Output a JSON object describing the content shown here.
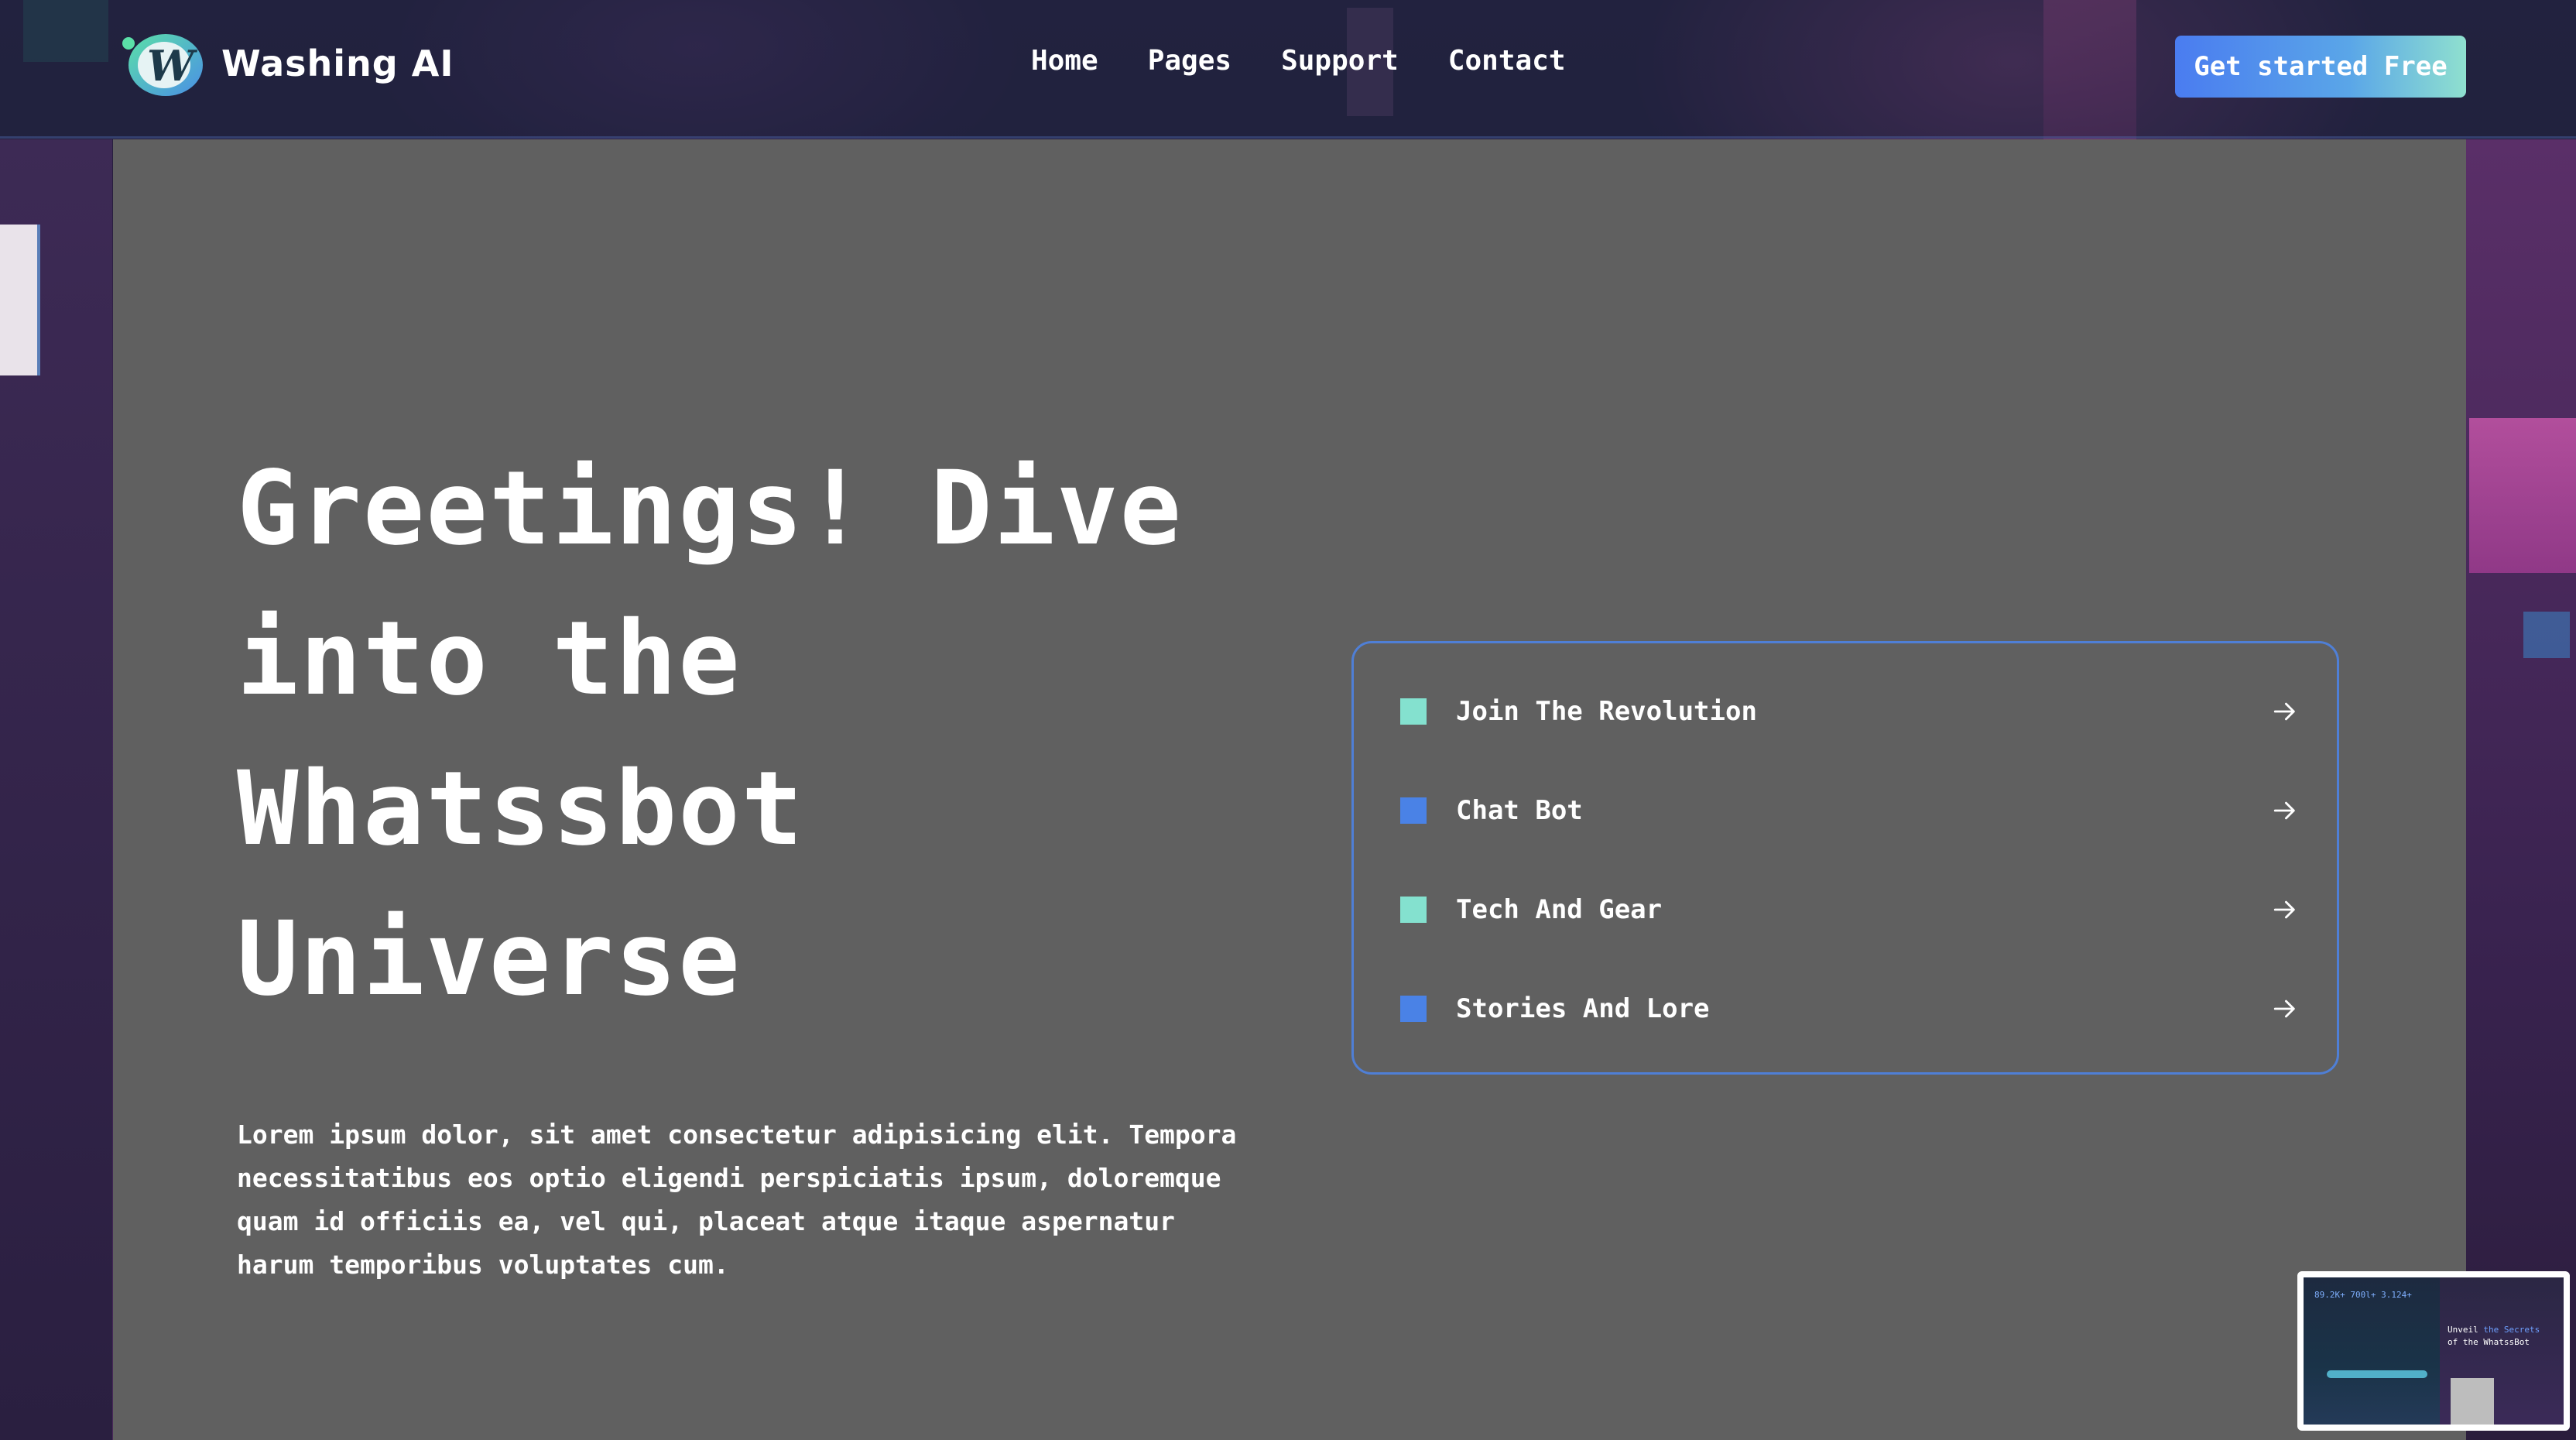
{
  "brand": {
    "name": "Washing AI",
    "logo_letter": "W"
  },
  "nav": {
    "links": [
      "Home",
      "Pages",
      "Support",
      "Contact"
    ],
    "cta_label": "Get started Free"
  },
  "hero": {
    "title_lines": [
      "Greetings! Dive",
      "into the",
      "Whatssbot",
      "Universe"
    ],
    "description": "Lorem ipsum dolor, sit amet consectetur adipisicing elit. Tempora necessitatibus eos optio eligendi perspiciatis ipsum, doloremque quam id officiis ea, vel qui, placeat atque itaque aspernatur harum temporibus voluptates cum."
  },
  "menu": {
    "items": [
      {
        "label": "Join The Revolution",
        "color": "#84e1cf",
        "icon": "arrow-right-icon"
      },
      {
        "label": "Chat Bot",
        "color": "#4a82e6",
        "icon": "arrow-right-icon"
      },
      {
        "label": "Tech And Gear",
        "color": "#84e1cf",
        "icon": "arrow-right-icon"
      },
      {
        "label": "Stories And Lore",
        "color": "#4a82e6",
        "icon": "arrow-right-icon"
      }
    ]
  },
  "thumbnail": {
    "stats": "89.2K+ 700l+ 3.124+",
    "heading_line1_pre": "Unveil ",
    "heading_line1_hl": "the Secrets",
    "heading_line2": "of the WhatssBot"
  },
  "colors": {
    "accent_blue": "#4a82e6",
    "accent_mint": "#84e1cf",
    "panel_gray": "#606060",
    "border_blue": "#4f7fd6"
  }
}
